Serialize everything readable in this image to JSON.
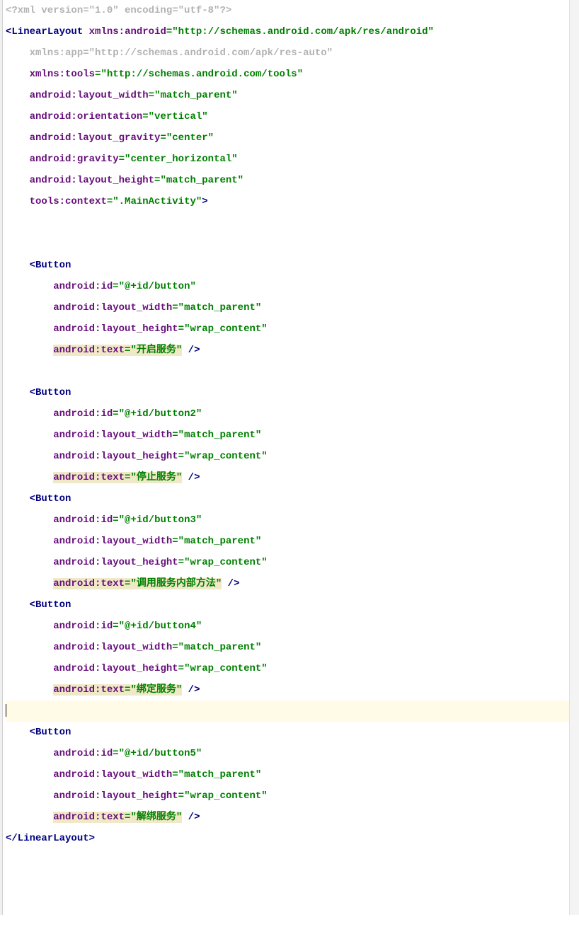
{
  "xml_decl": "<?xml version=\"1.0\" encoding=\"utf-8\"?>",
  "root_tag": "LinearLayout",
  "root_close": "</LinearLayout>",
  "root_attrs": [
    {
      "ns": "xmlns",
      "name": "android",
      "value": "http://schemas.android.com/apk/res/android",
      "gray": false
    },
    {
      "ns": "xmlns",
      "name": "app",
      "value": "http://schemas.android.com/apk/res-auto",
      "gray": true
    },
    {
      "ns": "xmlns",
      "name": "tools",
      "value": "http://schemas.android.com/tools",
      "gray": false
    },
    {
      "ns": "android",
      "name": "layout_width",
      "value": "match_parent",
      "gray": false
    },
    {
      "ns": "android",
      "name": "orientation",
      "value": "vertical",
      "gray": false
    },
    {
      "ns": "android",
      "name": "layout_gravity",
      "value": "center",
      "gray": false
    },
    {
      "ns": "android",
      "name": "gravity",
      "value": "center_horizontal",
      "gray": false
    },
    {
      "ns": "android",
      "name": "layout_height",
      "value": "match_parent",
      "gray": false
    },
    {
      "ns": "tools",
      "name": "context",
      "value": ".MainActivity",
      "gray": false
    }
  ],
  "buttons": [
    {
      "tag": "Button",
      "attrs": [
        {
          "ns": "android",
          "name": "id",
          "value": "@+id/button",
          "hl": false
        },
        {
          "ns": "android",
          "name": "layout_width",
          "value": "match_parent",
          "hl": false
        },
        {
          "ns": "android",
          "name": "layout_height",
          "value": "wrap_content",
          "hl": false
        },
        {
          "ns": "android",
          "name": "text",
          "value": "开启服务",
          "hl": true
        }
      ],
      "blank_before": true
    },
    {
      "tag": "Button",
      "attrs": [
        {
          "ns": "android",
          "name": "id",
          "value": "@+id/button2",
          "hl": false
        },
        {
          "ns": "android",
          "name": "layout_width",
          "value": "match_parent",
          "hl": false
        },
        {
          "ns": "android",
          "name": "layout_height",
          "value": "wrap_content",
          "hl": false
        },
        {
          "ns": "android",
          "name": "text",
          "value": "停止服务",
          "hl": true
        }
      ],
      "blank_before": true
    },
    {
      "tag": "Button",
      "attrs": [
        {
          "ns": "android",
          "name": "id",
          "value": "@+id/button3",
          "hl": false
        },
        {
          "ns": "android",
          "name": "layout_width",
          "value": "match_parent",
          "hl": false
        },
        {
          "ns": "android",
          "name": "layout_height",
          "value": "wrap_content",
          "hl": false
        },
        {
          "ns": "android",
          "name": "text",
          "value": "调用服务内部方法",
          "hl": true
        }
      ],
      "blank_before": false
    },
    {
      "tag": "Button",
      "attrs": [
        {
          "ns": "android",
          "name": "id",
          "value": "@+id/button4",
          "hl": false
        },
        {
          "ns": "android",
          "name": "layout_width",
          "value": "match_parent",
          "hl": false
        },
        {
          "ns": "android",
          "name": "layout_height",
          "value": "wrap_content",
          "hl": false
        },
        {
          "ns": "android",
          "name": "text",
          "value": "绑定服务",
          "hl": true
        }
      ],
      "blank_before": false,
      "cursor_after": true
    },
    {
      "tag": "Button",
      "attrs": [
        {
          "ns": "android",
          "name": "id",
          "value": "@+id/button5",
          "hl": false
        },
        {
          "ns": "android",
          "name": "layout_width",
          "value": "match_parent",
          "hl": false
        },
        {
          "ns": "android",
          "name": "layout_height",
          "value": "wrap_content",
          "hl": false
        },
        {
          "ns": "android",
          "name": "text",
          "value": "解绑服务",
          "hl": true
        }
      ],
      "blank_before": false
    }
  ]
}
